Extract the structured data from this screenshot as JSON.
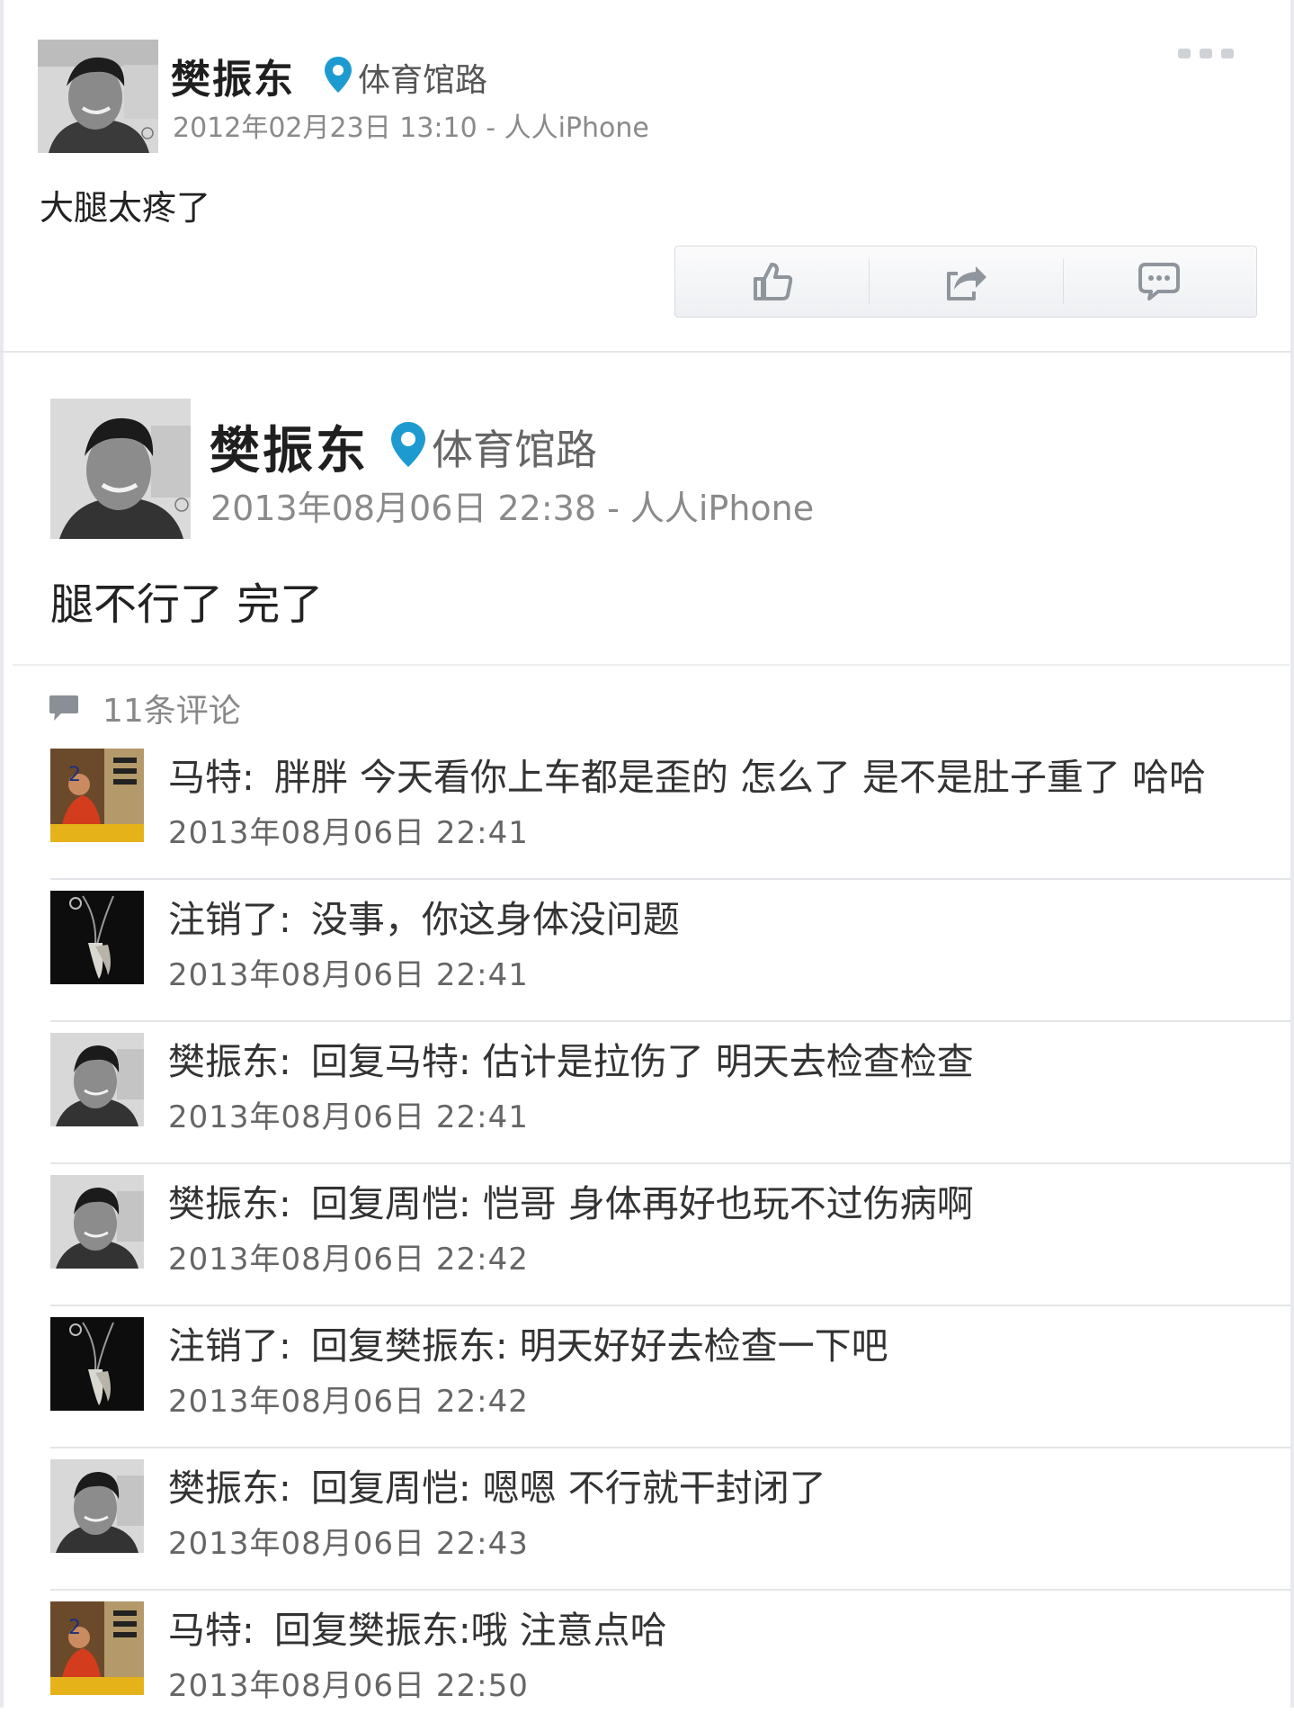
{
  "post1": {
    "author": "樊振东",
    "location": "体育馆路",
    "meta": "2012年02月23日 13:10 - 人人iPhone",
    "text": "大腿太疼了",
    "actions": [
      "like-icon",
      "share-icon",
      "comment-icon"
    ]
  },
  "post2": {
    "author": "樊振东",
    "location": "体育馆路",
    "meta": "2013年08月06日 22:38 - 人人iPhone",
    "text": "腿不行了 完了",
    "comments_count": "11条评论",
    "comments": [
      {
        "user": "马特",
        "sep": ":",
        "text": "胖胖 今天看你上车都是歪的  怎么了 是不是肚子重了 哈哈",
        "time": "2013年08月06日 22:41",
        "avatar": "avatar-table-tennis"
      },
      {
        "user": "注销了",
        "sep": ":",
        "text": "没事，你这身体没问题",
        "time": "2013年08月06日 22:41",
        "avatar": "avatar-necklace"
      },
      {
        "user": "樊振东",
        "sep": ":",
        "text": "回复马特: 估计是拉伤了 明天去检查检查",
        "time": "2013年08月06日 22:41",
        "avatar": "avatar-portrait"
      },
      {
        "user": "樊振东",
        "sep": ":",
        "text": "回复周恺: 恺哥 身体再好也玩不过伤病啊",
        "time": "2013年08月06日 22:42",
        "avatar": "avatar-portrait"
      },
      {
        "user": "注销了",
        "sep": ":",
        "text": "回复樊振东: 明天好好去检查一下吧",
        "time": "2013年08月06日 22:42",
        "avatar": "avatar-necklace"
      },
      {
        "user": "樊振东",
        "sep": ":",
        "text": "回复周恺: 嗯嗯 不行就干封闭了",
        "time": "2013年08月06日 22:43",
        "avatar": "avatar-portrait"
      },
      {
        "user": "马特",
        "sep": ":",
        "text": "回复樊振东:哦  注意点哈",
        "time": "2013年08月06日 22:50",
        "avatar": "avatar-table-tennis"
      }
    ]
  },
  "colors": {
    "location_pin": "#1d9bd1",
    "icon_gray": "#8f959c",
    "divider": "#e3e5e8"
  }
}
